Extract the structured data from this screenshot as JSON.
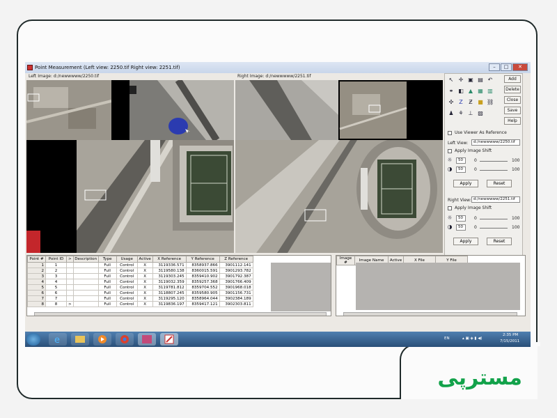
{
  "window": {
    "title": "Point Measurement (Left view: 2250.tif  Right view: 2251.tif)",
    "left_image_label": "Left Image: d:/newwwww/2250.tif",
    "right_image_label": "Right Image: d:/newwwww/2251.tif"
  },
  "tools": {
    "add_label": "Add",
    "delete_label": "Delete",
    "close_label": "Close",
    "save_label": "Save",
    "help_label": "Help",
    "use_viewer_ref": "Use Viewer As Reference",
    "left_view_label": "Left View:",
    "left_view_value": "d:/newwwww/2250.tif",
    "apply_shift_left": "Apply Image Shift",
    "brightness_left": "50",
    "contrast_left": "50",
    "bright_zero_left": "0",
    "bright_max_left": "100",
    "contrast_zero_left": "0",
    "contrast_max_left": "100",
    "apply_left": "Apply",
    "reset_left": "Reset",
    "right_view_label": "Right View:",
    "right_view_value": "d:/newwwww/2251.tif",
    "apply_shift_right": "Apply Image Shift",
    "brightness_right": "50",
    "contrast_right": "50",
    "bright_zero_right": "0",
    "bright_max_right": "100",
    "contrast_zero_right": "0",
    "contrast_max_right": "100",
    "apply_right": "Apply",
    "reset_right": "Reset"
  },
  "points_table": {
    "headers": [
      "Point #",
      "Point ID",
      ">",
      "Description",
      "Type",
      "Usage",
      "Active",
      "X Reference",
      "Y Reference",
      "Z Reference"
    ],
    "rows": [
      [
        "1",
        "1",
        "",
        "",
        "Full",
        "Control",
        "X",
        "3119336.571",
        "8358937.866",
        "3901112.141"
      ],
      [
        "2",
        "2",
        "",
        "",
        "Full",
        "Control",
        "X",
        "3119580.138",
        "8360015.591",
        "3901293.782"
      ],
      [
        "3",
        "3",
        "",
        "",
        "Full",
        "Control",
        "X",
        "3119303.245",
        "8359410.902",
        "3901792.387"
      ],
      [
        "4",
        "4",
        "",
        "",
        "Full",
        "Control",
        "X",
        "3119032.359",
        "8359257.368",
        "3901766.409"
      ],
      [
        "5",
        "5",
        "",
        "",
        "Full",
        "Control",
        "X",
        "3119781.812",
        "8359704.552",
        "3901968.018"
      ],
      [
        "6",
        "6",
        "",
        "",
        "Full",
        "Control",
        "X",
        "3118807.245",
        "8359580.905",
        "3901156.731"
      ],
      [
        "7",
        "7",
        "",
        "",
        "Full",
        "Control",
        "X",
        "3119295.120",
        "8358964.044",
        "3902384.189"
      ],
      [
        "8",
        "8",
        ">",
        "",
        "Full",
        "Control",
        "X",
        "3119836.197",
        "8359417.121",
        "3902303.811"
      ]
    ]
  },
  "image_table": {
    "headers": [
      "Image #",
      "Image Name",
      "Active",
      "X File",
      "Y File"
    ]
  },
  "tray": {
    "lang": "EN",
    "time": "2:35 PM",
    "date": "7/15/2011"
  },
  "brand": {
    "logo_text": "مسترپی",
    "color": "#12a24a"
  }
}
